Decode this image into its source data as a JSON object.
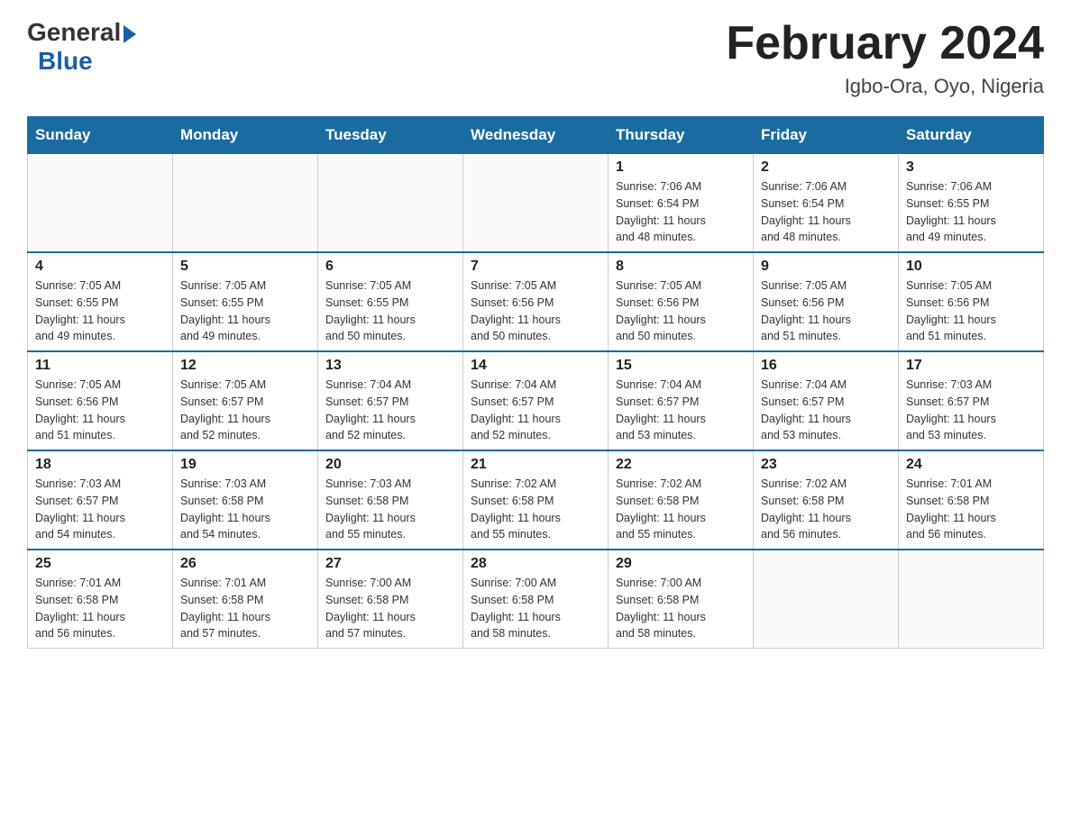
{
  "header": {
    "logo": {
      "general": "General",
      "blue": "Blue"
    },
    "title": "February 2024",
    "location": "Igbo-Ora, Oyo, Nigeria"
  },
  "days_of_week": [
    "Sunday",
    "Monday",
    "Tuesday",
    "Wednesday",
    "Thursday",
    "Friday",
    "Saturday"
  ],
  "weeks": [
    [
      {
        "day": "",
        "info": ""
      },
      {
        "day": "",
        "info": ""
      },
      {
        "day": "",
        "info": ""
      },
      {
        "day": "",
        "info": ""
      },
      {
        "day": "1",
        "info": "Sunrise: 7:06 AM\nSunset: 6:54 PM\nDaylight: 11 hours\nand 48 minutes."
      },
      {
        "day": "2",
        "info": "Sunrise: 7:06 AM\nSunset: 6:54 PM\nDaylight: 11 hours\nand 48 minutes."
      },
      {
        "day": "3",
        "info": "Sunrise: 7:06 AM\nSunset: 6:55 PM\nDaylight: 11 hours\nand 49 minutes."
      }
    ],
    [
      {
        "day": "4",
        "info": "Sunrise: 7:05 AM\nSunset: 6:55 PM\nDaylight: 11 hours\nand 49 minutes."
      },
      {
        "day": "5",
        "info": "Sunrise: 7:05 AM\nSunset: 6:55 PM\nDaylight: 11 hours\nand 49 minutes."
      },
      {
        "day": "6",
        "info": "Sunrise: 7:05 AM\nSunset: 6:55 PM\nDaylight: 11 hours\nand 50 minutes."
      },
      {
        "day": "7",
        "info": "Sunrise: 7:05 AM\nSunset: 6:56 PM\nDaylight: 11 hours\nand 50 minutes."
      },
      {
        "day": "8",
        "info": "Sunrise: 7:05 AM\nSunset: 6:56 PM\nDaylight: 11 hours\nand 50 minutes."
      },
      {
        "day": "9",
        "info": "Sunrise: 7:05 AM\nSunset: 6:56 PM\nDaylight: 11 hours\nand 51 minutes."
      },
      {
        "day": "10",
        "info": "Sunrise: 7:05 AM\nSunset: 6:56 PM\nDaylight: 11 hours\nand 51 minutes."
      }
    ],
    [
      {
        "day": "11",
        "info": "Sunrise: 7:05 AM\nSunset: 6:56 PM\nDaylight: 11 hours\nand 51 minutes."
      },
      {
        "day": "12",
        "info": "Sunrise: 7:05 AM\nSunset: 6:57 PM\nDaylight: 11 hours\nand 52 minutes."
      },
      {
        "day": "13",
        "info": "Sunrise: 7:04 AM\nSunset: 6:57 PM\nDaylight: 11 hours\nand 52 minutes."
      },
      {
        "day": "14",
        "info": "Sunrise: 7:04 AM\nSunset: 6:57 PM\nDaylight: 11 hours\nand 52 minutes."
      },
      {
        "day": "15",
        "info": "Sunrise: 7:04 AM\nSunset: 6:57 PM\nDaylight: 11 hours\nand 53 minutes."
      },
      {
        "day": "16",
        "info": "Sunrise: 7:04 AM\nSunset: 6:57 PM\nDaylight: 11 hours\nand 53 minutes."
      },
      {
        "day": "17",
        "info": "Sunrise: 7:03 AM\nSunset: 6:57 PM\nDaylight: 11 hours\nand 53 minutes."
      }
    ],
    [
      {
        "day": "18",
        "info": "Sunrise: 7:03 AM\nSunset: 6:57 PM\nDaylight: 11 hours\nand 54 minutes."
      },
      {
        "day": "19",
        "info": "Sunrise: 7:03 AM\nSunset: 6:58 PM\nDaylight: 11 hours\nand 54 minutes."
      },
      {
        "day": "20",
        "info": "Sunrise: 7:03 AM\nSunset: 6:58 PM\nDaylight: 11 hours\nand 55 minutes."
      },
      {
        "day": "21",
        "info": "Sunrise: 7:02 AM\nSunset: 6:58 PM\nDaylight: 11 hours\nand 55 minutes."
      },
      {
        "day": "22",
        "info": "Sunrise: 7:02 AM\nSunset: 6:58 PM\nDaylight: 11 hours\nand 55 minutes."
      },
      {
        "day": "23",
        "info": "Sunrise: 7:02 AM\nSunset: 6:58 PM\nDaylight: 11 hours\nand 56 minutes."
      },
      {
        "day": "24",
        "info": "Sunrise: 7:01 AM\nSunset: 6:58 PM\nDaylight: 11 hours\nand 56 minutes."
      }
    ],
    [
      {
        "day": "25",
        "info": "Sunrise: 7:01 AM\nSunset: 6:58 PM\nDaylight: 11 hours\nand 56 minutes."
      },
      {
        "day": "26",
        "info": "Sunrise: 7:01 AM\nSunset: 6:58 PM\nDaylight: 11 hours\nand 57 minutes."
      },
      {
        "day": "27",
        "info": "Sunrise: 7:00 AM\nSunset: 6:58 PM\nDaylight: 11 hours\nand 57 minutes."
      },
      {
        "day": "28",
        "info": "Sunrise: 7:00 AM\nSunset: 6:58 PM\nDaylight: 11 hours\nand 58 minutes."
      },
      {
        "day": "29",
        "info": "Sunrise: 7:00 AM\nSunset: 6:58 PM\nDaylight: 11 hours\nand 58 minutes."
      },
      {
        "day": "",
        "info": ""
      },
      {
        "day": "",
        "info": ""
      }
    ]
  ]
}
